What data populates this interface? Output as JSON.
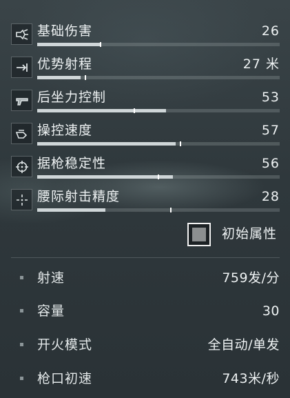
{
  "stats": [
    {
      "label": "基础伤害",
      "value": "26",
      "fill": 0.26,
      "marker": 0.26,
      "icon": "damage-icon"
    },
    {
      "label": "优势射程",
      "value": "27 米",
      "fill": 0.18,
      "marker": 0.2,
      "icon": "range-icon"
    },
    {
      "label": "后坐力控制",
      "value": "53",
      "fill": 0.53,
      "marker": 0.4,
      "icon": "recoil-icon"
    },
    {
      "label": "操控速度",
      "value": "57",
      "fill": 0.57,
      "marker": 0.59,
      "icon": "handling-icon"
    },
    {
      "label": "据枪稳定性",
      "value": "56",
      "fill": 0.56,
      "marker": 0.5,
      "icon": "stability-icon"
    },
    {
      "label": "腰际射击精度",
      "value": "28",
      "fill": 0.28,
      "marker": 0.55,
      "icon": "hipfire-icon"
    }
  ],
  "toggle": {
    "label": "初始属性",
    "checked": true
  },
  "specs": [
    {
      "label": "射速",
      "value": "759发/分"
    },
    {
      "label": "容量",
      "value": "30"
    },
    {
      "label": "开火模式",
      "value": "全自动/单发"
    },
    {
      "label": "枪口初速",
      "value": "743米/秒"
    }
  ]
}
